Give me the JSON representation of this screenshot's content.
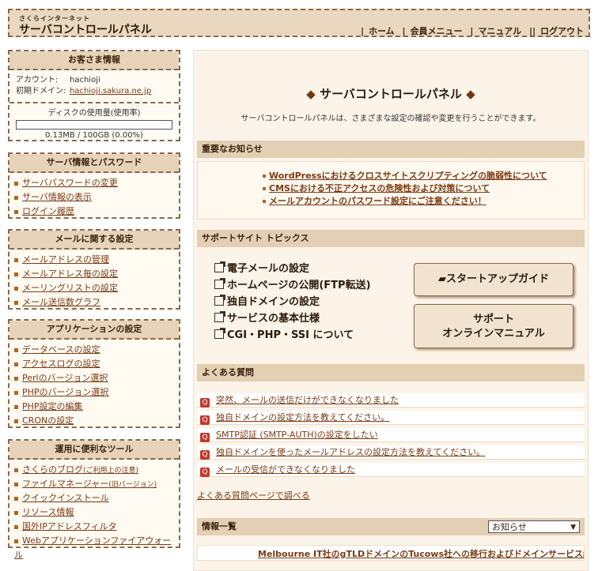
{
  "header": {
    "brand_small": "さくらインターネット",
    "brand": "サーバコントロールパネル",
    "nav": [
      "ホーム",
      "会員メニュー",
      "マニュアル",
      "ログアウト"
    ]
  },
  "customer": {
    "title": "お客さま情報",
    "account_label": "アカウント:",
    "account_value": "hachioji",
    "domain_label": "初期ドメイン:",
    "domain_value": "hachioji.sakura.ne.jp",
    "disk_label": "ディスクの使用量(使用率)",
    "disk_value": "0.13MB / 100GB (0.00%)",
    "disk_usage_fraction": 0.0
  },
  "sidebar": {
    "server": {
      "title": "サーバ情報とパスワード",
      "items": [
        "サーバパスワードの変更",
        "サーバ情報の表示",
        "ログイン履歴"
      ]
    },
    "mail": {
      "title": "メールに関する設定",
      "items": [
        "メールアドレスの管理",
        "メールアドレス毎の設定",
        "メーリングリストの設定",
        "メール送信数グラフ"
      ]
    },
    "app": {
      "title": "アプリケーションの設定",
      "items": [
        "データベースの設定",
        "アクセスログの設定",
        "Perlのバージョン選択",
        "PHPのバージョン選択",
        "PHP設定の編集",
        "CRONの設定"
      ]
    },
    "tools": {
      "title": "運用に便利なツール",
      "items": [
        "さくらのブログ",
        "ファイルマネージャー",
        "クイックインストール",
        "リソース情報",
        "国外IPアドレスフィルタ",
        "Webアプリケーションファイアウォール"
      ],
      "notes": [
        "(ご利用上の注意)",
        "(旧バージョン)"
      ]
    }
  },
  "main": {
    "title": "サーバコントロールパネル",
    "desc": "サーバコントロールパネルは、さまざまな設定の確認や変更を行うことができます。",
    "notice_title": "重要なお知らせ",
    "notices": [
      "WordPressにおけるクロスサイトスクリプティングの脆弱性について",
      "CMSにおける不正アクセスの危険性および対策について",
      "メールアカウントのパスワード設定にご注意ください！"
    ],
    "topics_title": "サポートサイト トピックス",
    "topics": [
      "電子メールの設定",
      "ホームページの公開(FTP転送)",
      "独自ドメインの設定",
      "サービスの基本仕様",
      "CGI・PHP・SSI について"
    ],
    "startup_button": "スタートアップガイド",
    "manual_button_1": "サポート",
    "manual_button_2": "オンラインマニュアル",
    "faq_title": "よくある質問",
    "faqs": [
      "突然、メールの送信だけができなくなりました",
      "独自ドメインの設定方法を教えてください。",
      "SMTP認証 (SMTP-AUTH)の設定をしたい",
      "独自ドメインを使ったメールアドレスの設定方法を教えてください。",
      "メールの受信ができなくなりました"
    ],
    "faq_link": "よくある質問ページで調べる",
    "info_title": "情報一覧",
    "info_select": "お知らせ",
    "info_row_text": "Melbourne IT社のgTLDドメインのTucows社への移行およびドメインサービス終了決定"
  }
}
